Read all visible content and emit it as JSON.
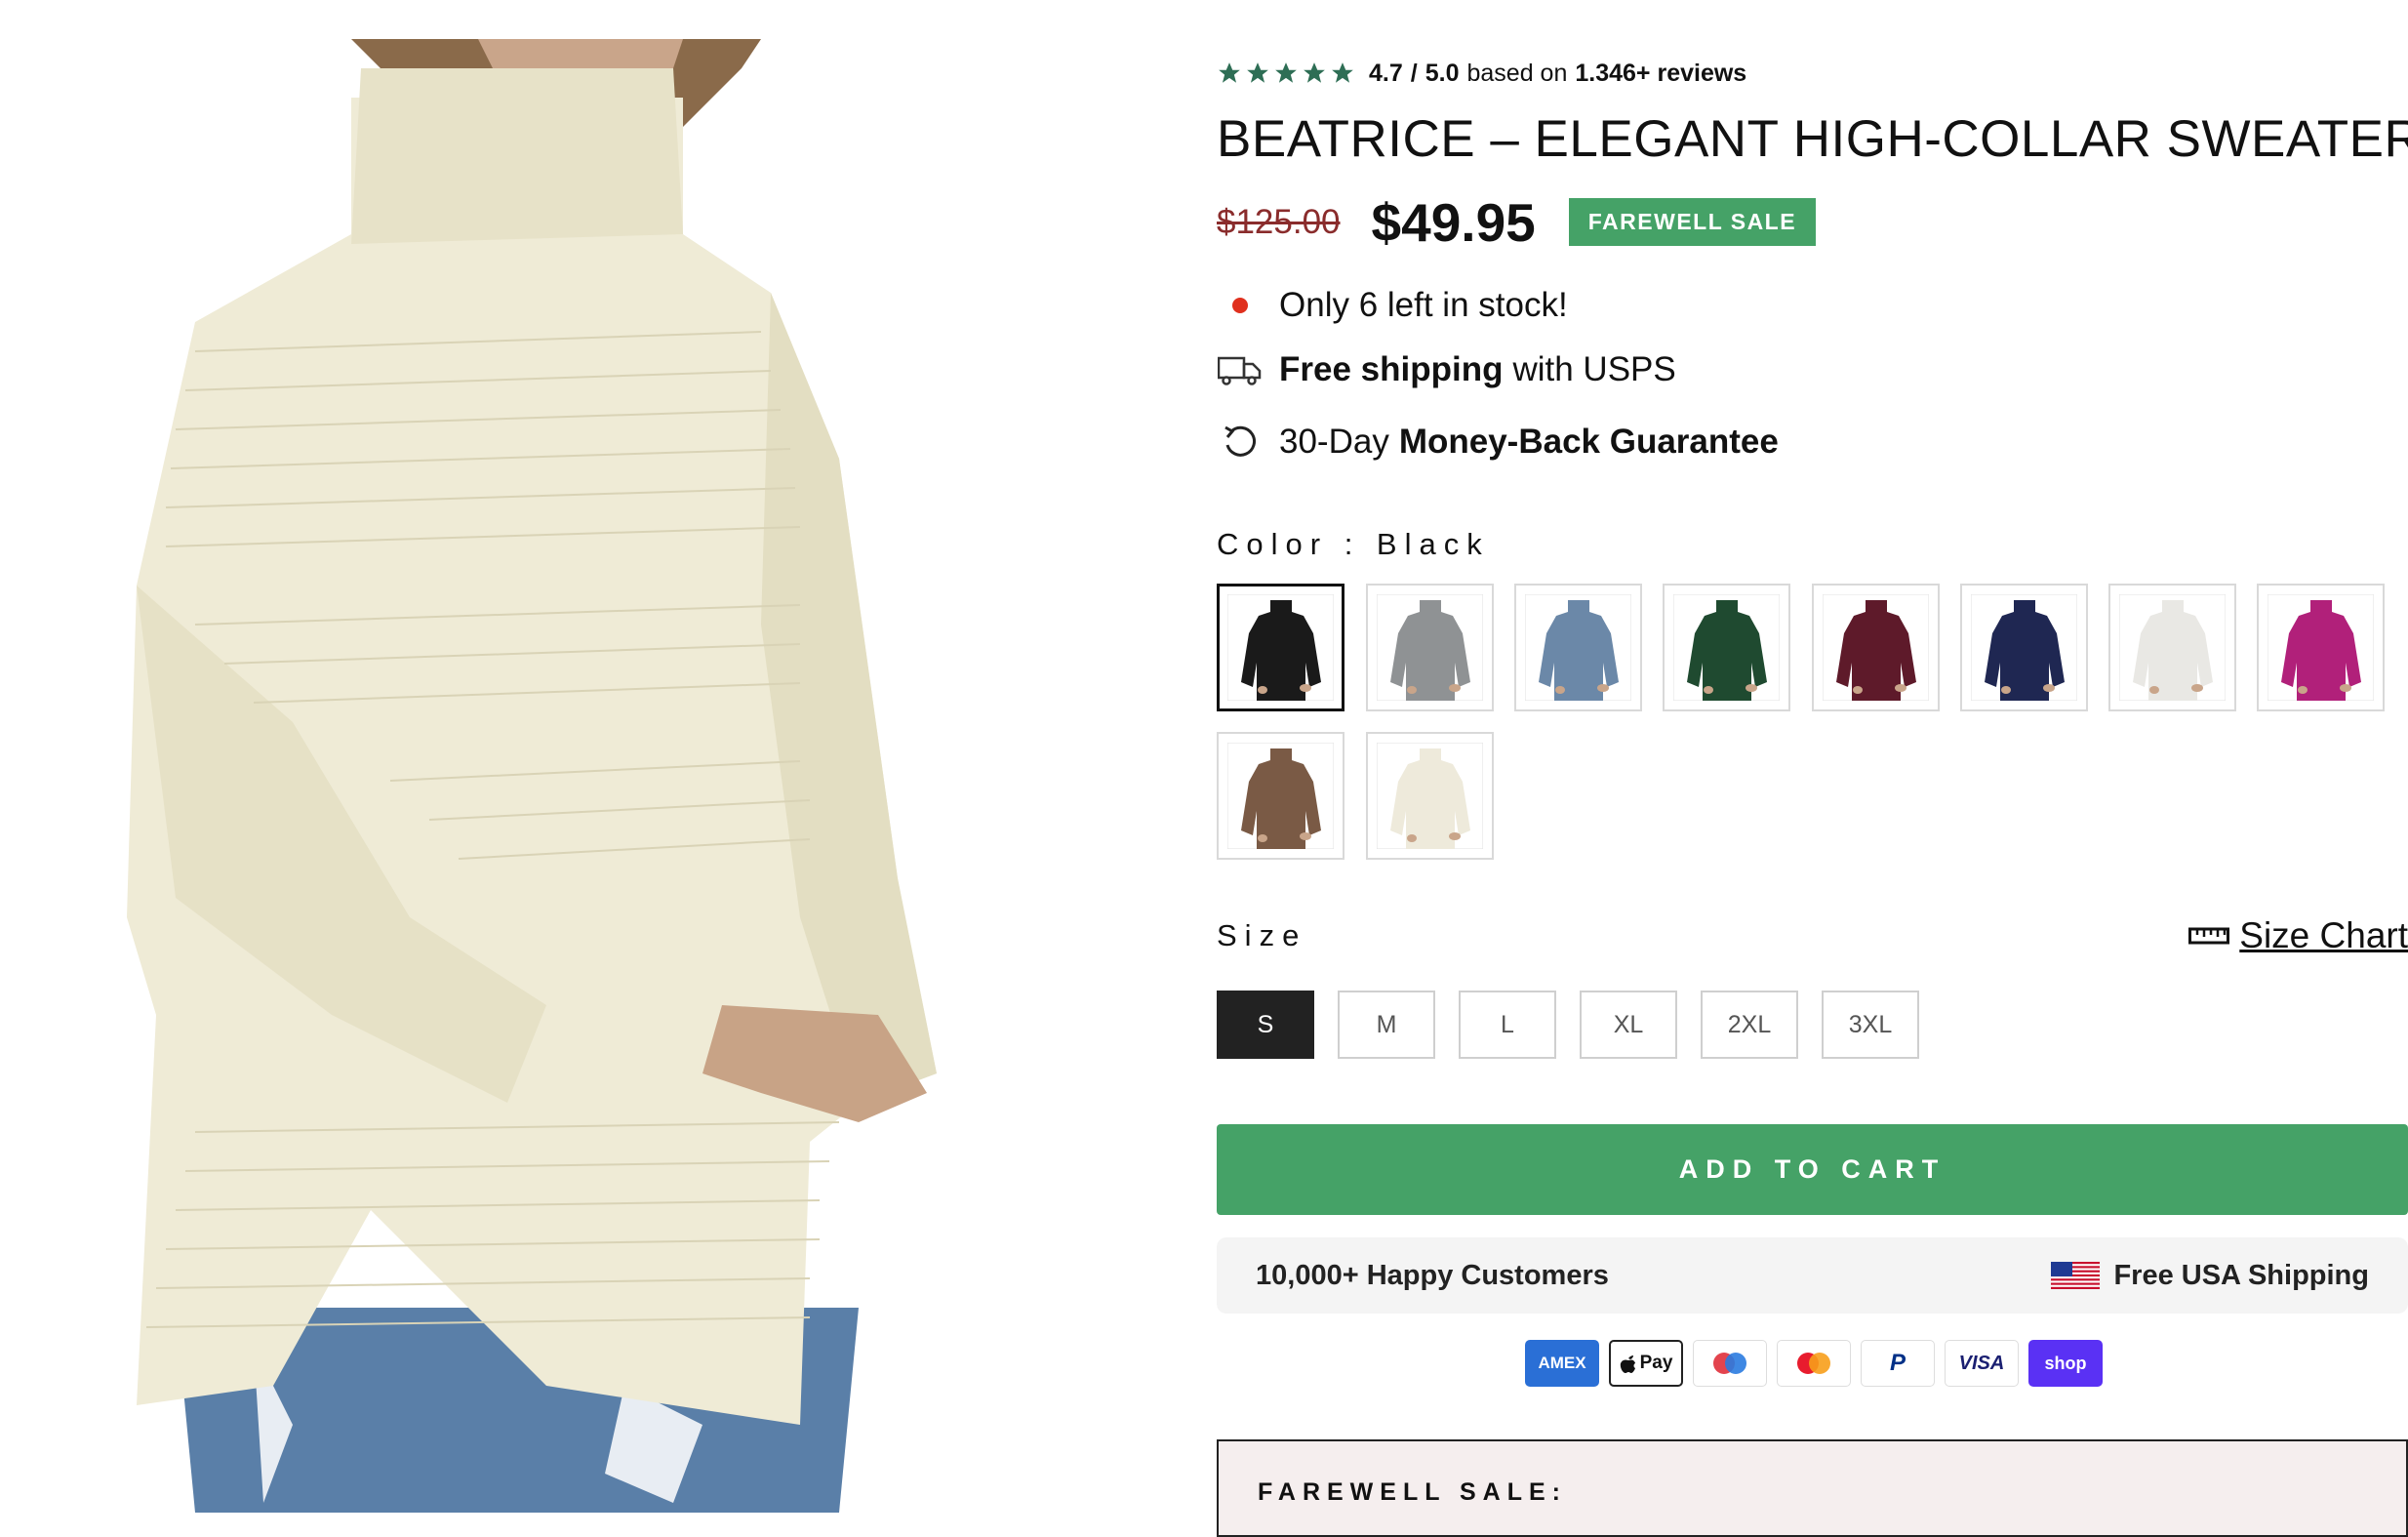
{
  "product_image": {
    "alt_icon": "product-photo"
  },
  "rating": {
    "score": "4.7",
    "separator": "/",
    "max": "5.0",
    "based_on": "based on",
    "reviews": "1.346+ reviews",
    "star_color": "#2e6e55"
  },
  "title": "BEATRICE – ELEGANT HIGH-COLLAR SWEATER",
  "price": {
    "original": "$125.00",
    "current": "$49.95",
    "badge": "FAREWELL SALE"
  },
  "features": {
    "stock": "Only 6 left in stock!",
    "shipping_bold": "Free shipping",
    "shipping_rest": "with USPS",
    "guarantee_pre": "30-Day",
    "guarantee_bold": "Money-Back Guarantee"
  },
  "color": {
    "label": "Color : Black",
    "selected": "Black",
    "swatches": [
      {
        "name": "Black",
        "hex": "#1a1a1a"
      },
      {
        "name": "Gray",
        "hex": "#8f9294"
      },
      {
        "name": "Blue",
        "hex": "#6b88a8"
      },
      {
        "name": "Green",
        "hex": "#1f4a30"
      },
      {
        "name": "Burgundy",
        "hex": "#5e1a2a"
      },
      {
        "name": "Navy",
        "hex": "#1f2752"
      },
      {
        "name": "White",
        "hex": "#e9e8e4"
      },
      {
        "name": "Magenta",
        "hex": "#b1207a"
      },
      {
        "name": "Brown",
        "hex": "#7a5a45"
      },
      {
        "name": "Cream",
        "hex": "#eeeadb"
      }
    ]
  },
  "size": {
    "label": "Size",
    "chart_link": "Size Chart",
    "selected": "S",
    "options": [
      "S",
      "M",
      "L",
      "XL",
      "2XL",
      "3XL"
    ]
  },
  "cta": {
    "add_to_cart": "ADD TO CART",
    "color": "#45a267"
  },
  "trust": {
    "customers": "10,000+ Happy Customers",
    "shipping": "Free USA Shipping"
  },
  "payments": [
    "AMEX",
    "Apple Pay",
    "Maestro",
    "Mastercard",
    "PayPal",
    "VISA",
    "shop"
  ],
  "farewell": {
    "title": "FAREWELL SALE:"
  }
}
